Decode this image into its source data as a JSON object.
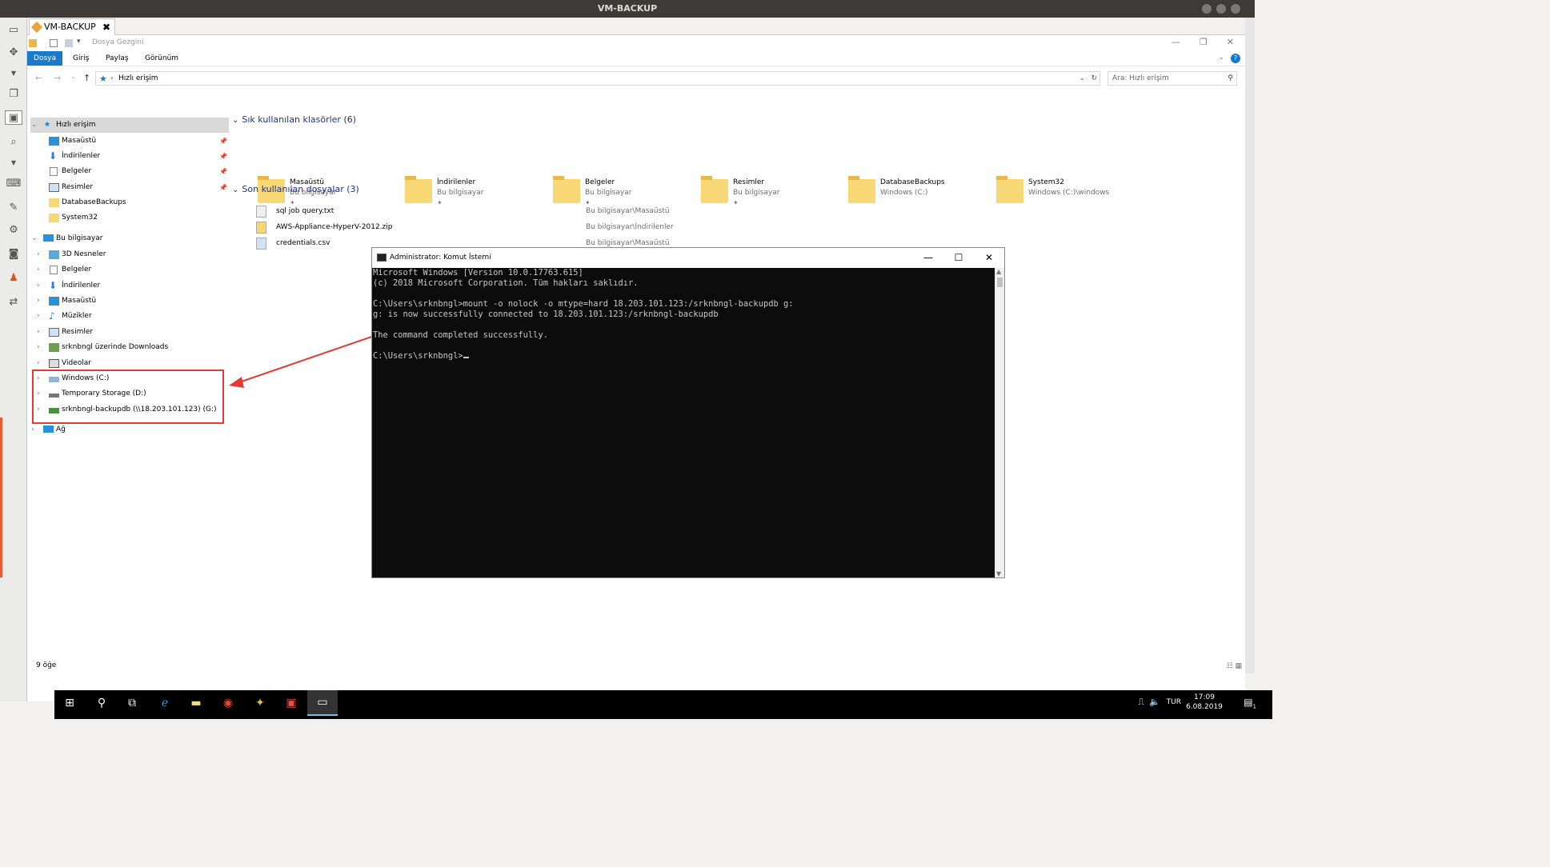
{
  "host": {
    "title": "VM-BACKUP",
    "vm_tab_label": "VM-BACKUP"
  },
  "explorer": {
    "window_title": "Dosya Gezgini",
    "ribbon_tabs": [
      "Dosya",
      "Giriş",
      "Paylaş",
      "Görünüm"
    ],
    "address": "Hızlı erişim",
    "search_placeholder": "Ara: Hızlı erişim",
    "nav": {
      "quick_access": "Hızlı erişim",
      "quick_items": [
        "Masaüstü",
        "İndirilenler",
        "Belgeler",
        "Resimler",
        "DatabaseBackups",
        "System32"
      ],
      "this_pc": "Bu bilgisayar",
      "pc_items": [
        "3D Nesneler",
        "Belgeler",
        "İndirilenler",
        "Masaüstü",
        "Müzikler",
        "Resimler",
        "srknbngl üzerinde Downloads",
        "Videolar",
        "Windows (C:)",
        "Temporary Storage (D:)",
        "srknbngl-backupdb (\\\\18.203.101.123) (G:)"
      ],
      "network": "Ağ"
    },
    "frequent_header": "Sık kullanılan klasörler (6)",
    "frequent": [
      {
        "name": "Masaüstü",
        "location": "Bu bilgisayar"
      },
      {
        "name": "İndirilenler",
        "location": "Bu bilgisayar"
      },
      {
        "name": "Belgeler",
        "location": "Bu bilgisayar"
      },
      {
        "name": "Resimler",
        "location": "Bu bilgisayar"
      },
      {
        "name": "DatabaseBackups",
        "location": "Windows (C:)"
      },
      {
        "name": "System32",
        "location": "Windows (C:)\\windows"
      }
    ],
    "recent_header": "Son kullanılan dosyalar (3)",
    "recent": [
      {
        "name": "sql job query.txt",
        "path": "Bu bilgisayar\\Masaüstü"
      },
      {
        "name": "AWS-Appliance-HyperV-2012.zip",
        "path": "Bu bilgisayar\\İndirilenler"
      },
      {
        "name": "credentials.csv",
        "path": "Bu bilgisayar\\Masaüstü"
      }
    ],
    "status": "9 öğe"
  },
  "cmd": {
    "title": "Administrator: Komut İstemi",
    "lines": [
      "Microsoft Windows [Version 10.0.17763.615]",
      "(c) 2018 Microsoft Corporation. Tüm hakları saklıdır.",
      "",
      "C:\\Users\\srknbngl>mount -o nolock -o mtype=hard 18.203.101.123:/srknbngl-backupdb g:",
      "g: is now successfully connected to 18.203.101.123:/srknbngl-backupdb",
      "",
      "The command completed successfully.",
      "",
      "C:\\Users\\srknbngl>"
    ]
  },
  "taskbar": {
    "lang": "TUR",
    "time": "17:09",
    "date": "6.08.2019",
    "notification_count": "1"
  },
  "colors": {
    "accent": "#1979ca",
    "annotation": "#e53935",
    "console_bg": "#0c0c0c"
  }
}
